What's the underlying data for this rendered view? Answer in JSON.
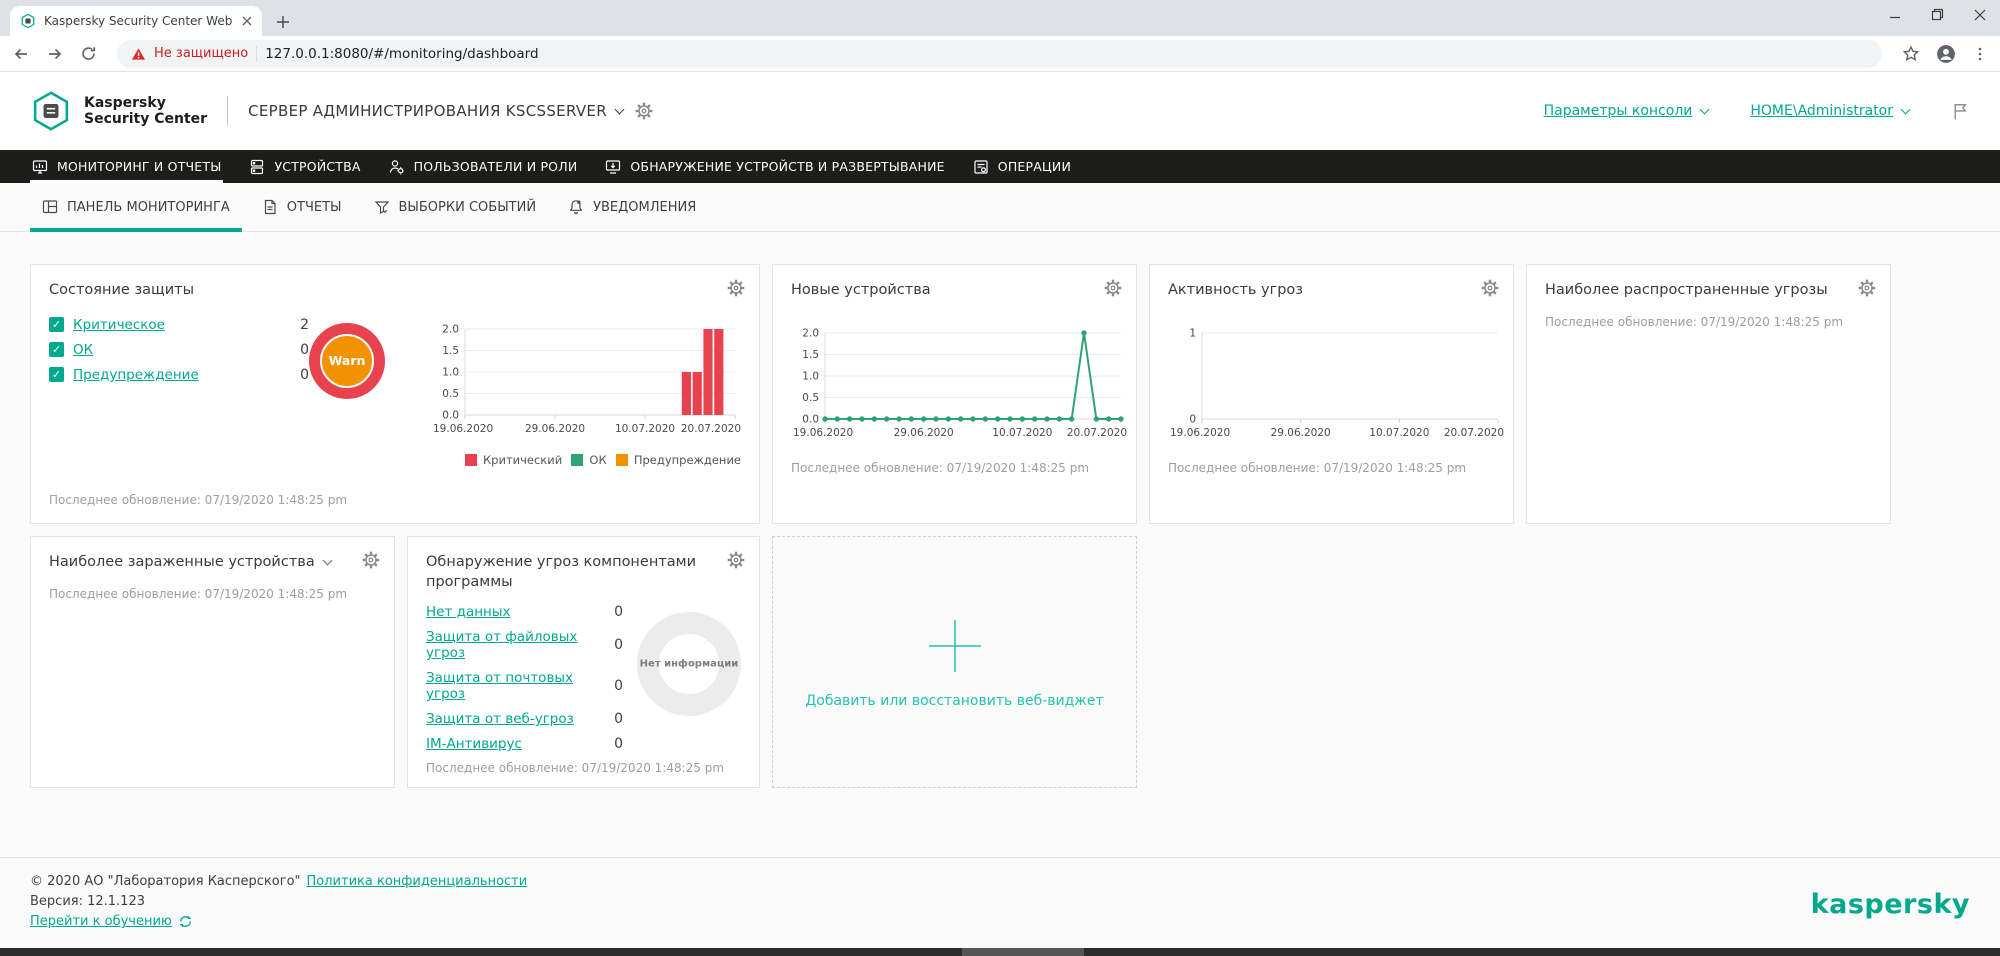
{
  "colors": {
    "accent": "#00a88e",
    "accent_light": "#25c2b0",
    "critical": "#e8424f",
    "ok": "#2fa372",
    "warning": "#f39200",
    "donut_empty": "#ececec"
  },
  "browser": {
    "tab_title": "Kaspersky Security Center Web C",
    "security_label": "Не защищено",
    "url": "127.0.0.1:8080/#/monitoring/dashboard"
  },
  "header": {
    "logo_line1": "Kaspersky",
    "logo_line2": "Security Center",
    "server_title": "СЕРВЕР АДМИНИСТРИРОВАНИЯ KSCSSERVER",
    "console_settings_label": "Параметры консоли",
    "user_label": "HOME\\Administrator"
  },
  "nav": {
    "items": [
      {
        "label": "МОНИТОРИНГ И ОТЧЕТЫ"
      },
      {
        "label": "УСТРОЙСТВА"
      },
      {
        "label": "ПОЛЬЗОВАТЕЛИ И РОЛИ"
      },
      {
        "label": "ОБНАРУЖЕНИЕ УСТРОЙСТВ И РАЗВЕРТЫВАНИЕ"
      },
      {
        "label": "ОПЕРАЦИИ"
      }
    ]
  },
  "subtabs": {
    "items": [
      {
        "label": "ПАНЕЛЬ МОНИТОРИНГА"
      },
      {
        "label": "ОТЧЕТЫ"
      },
      {
        "label": "ВЫБОРКИ СОБЫТИЙ"
      },
      {
        "label": "УВЕДОМЛЕНИЯ"
      }
    ]
  },
  "widgets": {
    "last_update": "Последнее обновление: 07/19/2020 1:48:25 pm",
    "protection": {
      "title": "Состояние защиты",
      "gauge_label": "Warn",
      "statuses": [
        {
          "label": "Критическое",
          "value": "2"
        },
        {
          "label": "ОК",
          "value": "0"
        },
        {
          "label": "Предупреждение",
          "value": "0"
        }
      ]
    },
    "new_devices": {
      "title": "Новые устройства"
    },
    "threat_activity": {
      "title": "Активность угроз"
    },
    "top_threats": {
      "title": "Наиболее распространенные угрозы"
    },
    "infected_devices": {
      "title": "Наиболее зараженные устройства"
    },
    "components": {
      "title": "Обнаружение угроз компонентами программы",
      "donut_label": "Нет информации",
      "rows": [
        {
          "label": "Нет данных",
          "value": "0"
        },
        {
          "label": "Защита от файловых угроз",
          "value": "0"
        },
        {
          "label": "Защита от почтовых угроз",
          "value": "0"
        },
        {
          "label": "Защита от веб-угроз",
          "value": "0"
        },
        {
          "label": "IM-Антивирус",
          "value": "0"
        }
      ]
    },
    "add_widget": {
      "label": "Добавить или восстановить веб-виджет"
    }
  },
  "footer": {
    "copyright": "© 2020 АО \"Лаборатория Касперского\"",
    "privacy_link": "Политика конфиденциальности",
    "version": "Версия: 12.1.123",
    "training_link": "Перейти к обучению",
    "brand": "kaspersky"
  },
  "chart_data": [
    {
      "type": "bar",
      "title": "Состояние защиты",
      "x_ticks": [
        "19.06.2020",
        "29.06.2020",
        "10.07.2020",
        "20.07.2020"
      ],
      "y_ticks": [
        "0.0",
        "0.5",
        "1.0",
        "1.5",
        "2.0"
      ],
      "ylim": [
        0,
        2
      ],
      "color": "#e8424f",
      "bar_slots": 25,
      "bar_start_slot": 20,
      "bars": [
        1,
        1,
        2,
        2
      ],
      "legend": [
        {
          "label": "Критический",
          "color": "#e8424f"
        },
        {
          "label": "ОК",
          "color": "#2fa372"
        },
        {
          "label": "Предупреждение",
          "color": "#f39200"
        }
      ]
    },
    {
      "type": "line",
      "title": "Новые устройства",
      "x_ticks": [
        "19.06.2020",
        "29.06.2020",
        "10.07.2020",
        "20.07.2020"
      ],
      "y_ticks": [
        "0.0",
        "0.5",
        "1.0",
        "1.5",
        "2.0"
      ],
      "ylim": [
        0,
        2
      ],
      "color": "#2fa372",
      "values": [
        0,
        0,
        0,
        0,
        0,
        0,
        0,
        0,
        0,
        0,
        0,
        0,
        0,
        0,
        0,
        0,
        0,
        0,
        0,
        0,
        0,
        2,
        0,
        0,
        0
      ]
    },
    {
      "type": "line",
      "title": "Активность угроз",
      "x_ticks": [
        "19.06.2020",
        "29.06.2020",
        "10.07.2020",
        "20.07.2020"
      ],
      "y_ticks": [
        "0",
        "1"
      ],
      "ylim": [
        0,
        1
      ],
      "color": "#2fa372",
      "values": []
    }
  ]
}
